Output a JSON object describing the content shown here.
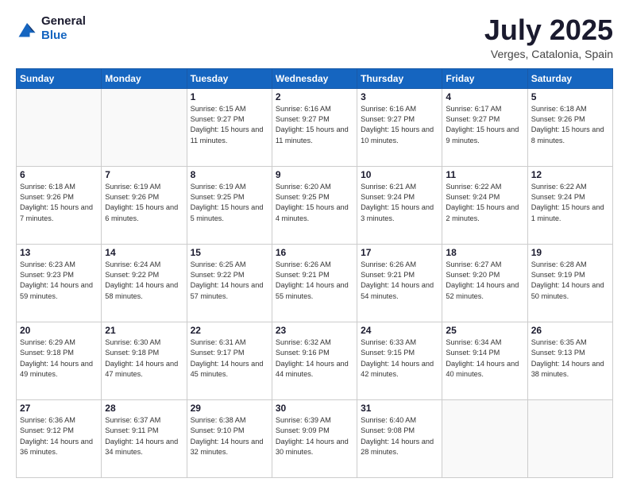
{
  "header": {
    "logo_line1": "General",
    "logo_line2": "Blue",
    "month_year": "July 2025",
    "location": "Verges, Catalonia, Spain"
  },
  "weekdays": [
    "Sunday",
    "Monday",
    "Tuesday",
    "Wednesday",
    "Thursday",
    "Friday",
    "Saturday"
  ],
  "weeks": [
    [
      {
        "day": "",
        "sunrise": "",
        "sunset": "",
        "daylight": ""
      },
      {
        "day": "",
        "sunrise": "",
        "sunset": "",
        "daylight": ""
      },
      {
        "day": "1",
        "sunrise": "Sunrise: 6:15 AM",
        "sunset": "Sunset: 9:27 PM",
        "daylight": "Daylight: 15 hours and 11 minutes."
      },
      {
        "day": "2",
        "sunrise": "Sunrise: 6:16 AM",
        "sunset": "Sunset: 9:27 PM",
        "daylight": "Daylight: 15 hours and 11 minutes."
      },
      {
        "day": "3",
        "sunrise": "Sunrise: 6:16 AM",
        "sunset": "Sunset: 9:27 PM",
        "daylight": "Daylight: 15 hours and 10 minutes."
      },
      {
        "day": "4",
        "sunrise": "Sunrise: 6:17 AM",
        "sunset": "Sunset: 9:27 PM",
        "daylight": "Daylight: 15 hours and 9 minutes."
      },
      {
        "day": "5",
        "sunrise": "Sunrise: 6:18 AM",
        "sunset": "Sunset: 9:26 PM",
        "daylight": "Daylight: 15 hours and 8 minutes."
      }
    ],
    [
      {
        "day": "6",
        "sunrise": "Sunrise: 6:18 AM",
        "sunset": "Sunset: 9:26 PM",
        "daylight": "Daylight: 15 hours and 7 minutes."
      },
      {
        "day": "7",
        "sunrise": "Sunrise: 6:19 AM",
        "sunset": "Sunset: 9:26 PM",
        "daylight": "Daylight: 15 hours and 6 minutes."
      },
      {
        "day": "8",
        "sunrise": "Sunrise: 6:19 AM",
        "sunset": "Sunset: 9:25 PM",
        "daylight": "Daylight: 15 hours and 5 minutes."
      },
      {
        "day": "9",
        "sunrise": "Sunrise: 6:20 AM",
        "sunset": "Sunset: 9:25 PM",
        "daylight": "Daylight: 15 hours and 4 minutes."
      },
      {
        "day": "10",
        "sunrise": "Sunrise: 6:21 AM",
        "sunset": "Sunset: 9:24 PM",
        "daylight": "Daylight: 15 hours and 3 minutes."
      },
      {
        "day": "11",
        "sunrise": "Sunrise: 6:22 AM",
        "sunset": "Sunset: 9:24 PM",
        "daylight": "Daylight: 15 hours and 2 minutes."
      },
      {
        "day": "12",
        "sunrise": "Sunrise: 6:22 AM",
        "sunset": "Sunset: 9:24 PM",
        "daylight": "Daylight: 15 hours and 1 minute."
      }
    ],
    [
      {
        "day": "13",
        "sunrise": "Sunrise: 6:23 AM",
        "sunset": "Sunset: 9:23 PM",
        "daylight": "Daylight: 14 hours and 59 minutes."
      },
      {
        "day": "14",
        "sunrise": "Sunrise: 6:24 AM",
        "sunset": "Sunset: 9:22 PM",
        "daylight": "Daylight: 14 hours and 58 minutes."
      },
      {
        "day": "15",
        "sunrise": "Sunrise: 6:25 AM",
        "sunset": "Sunset: 9:22 PM",
        "daylight": "Daylight: 14 hours and 57 minutes."
      },
      {
        "day": "16",
        "sunrise": "Sunrise: 6:26 AM",
        "sunset": "Sunset: 9:21 PM",
        "daylight": "Daylight: 14 hours and 55 minutes."
      },
      {
        "day": "17",
        "sunrise": "Sunrise: 6:26 AM",
        "sunset": "Sunset: 9:21 PM",
        "daylight": "Daylight: 14 hours and 54 minutes."
      },
      {
        "day": "18",
        "sunrise": "Sunrise: 6:27 AM",
        "sunset": "Sunset: 9:20 PM",
        "daylight": "Daylight: 14 hours and 52 minutes."
      },
      {
        "day": "19",
        "sunrise": "Sunrise: 6:28 AM",
        "sunset": "Sunset: 9:19 PM",
        "daylight": "Daylight: 14 hours and 50 minutes."
      }
    ],
    [
      {
        "day": "20",
        "sunrise": "Sunrise: 6:29 AM",
        "sunset": "Sunset: 9:18 PM",
        "daylight": "Daylight: 14 hours and 49 minutes."
      },
      {
        "day": "21",
        "sunrise": "Sunrise: 6:30 AM",
        "sunset": "Sunset: 9:18 PM",
        "daylight": "Daylight: 14 hours and 47 minutes."
      },
      {
        "day": "22",
        "sunrise": "Sunrise: 6:31 AM",
        "sunset": "Sunset: 9:17 PM",
        "daylight": "Daylight: 14 hours and 45 minutes."
      },
      {
        "day": "23",
        "sunrise": "Sunrise: 6:32 AM",
        "sunset": "Sunset: 9:16 PM",
        "daylight": "Daylight: 14 hours and 44 minutes."
      },
      {
        "day": "24",
        "sunrise": "Sunrise: 6:33 AM",
        "sunset": "Sunset: 9:15 PM",
        "daylight": "Daylight: 14 hours and 42 minutes."
      },
      {
        "day": "25",
        "sunrise": "Sunrise: 6:34 AM",
        "sunset": "Sunset: 9:14 PM",
        "daylight": "Daylight: 14 hours and 40 minutes."
      },
      {
        "day": "26",
        "sunrise": "Sunrise: 6:35 AM",
        "sunset": "Sunset: 9:13 PM",
        "daylight": "Daylight: 14 hours and 38 minutes."
      }
    ],
    [
      {
        "day": "27",
        "sunrise": "Sunrise: 6:36 AM",
        "sunset": "Sunset: 9:12 PM",
        "daylight": "Daylight: 14 hours and 36 minutes."
      },
      {
        "day": "28",
        "sunrise": "Sunrise: 6:37 AM",
        "sunset": "Sunset: 9:11 PM",
        "daylight": "Daylight: 14 hours and 34 minutes."
      },
      {
        "day": "29",
        "sunrise": "Sunrise: 6:38 AM",
        "sunset": "Sunset: 9:10 PM",
        "daylight": "Daylight: 14 hours and 32 minutes."
      },
      {
        "day": "30",
        "sunrise": "Sunrise: 6:39 AM",
        "sunset": "Sunset: 9:09 PM",
        "daylight": "Daylight: 14 hours and 30 minutes."
      },
      {
        "day": "31",
        "sunrise": "Sunrise: 6:40 AM",
        "sunset": "Sunset: 9:08 PM",
        "daylight": "Daylight: 14 hours and 28 minutes."
      },
      {
        "day": "",
        "sunrise": "",
        "sunset": "",
        "daylight": ""
      },
      {
        "day": "",
        "sunrise": "",
        "sunset": "",
        "daylight": ""
      }
    ]
  ]
}
